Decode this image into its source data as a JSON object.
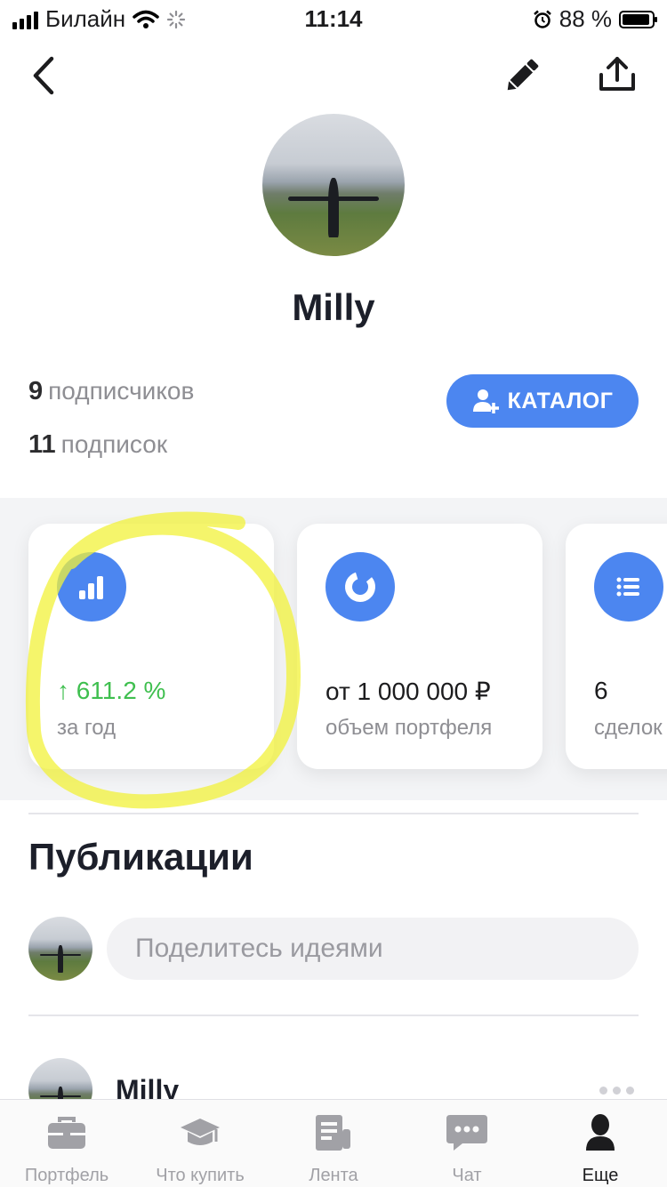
{
  "status_bar": {
    "carrier": "Билайн",
    "time": "11:14",
    "battery": "88 %"
  },
  "profile": {
    "name": "Milly",
    "followers_count": "9",
    "followers_label": "подписчиков",
    "following_count": "11",
    "following_label": "подписок",
    "catalog_button": "КАТАЛОГ"
  },
  "cards": [
    {
      "icon": "bar-chart-icon",
      "value": "↑ 611.2 %",
      "label": "за год",
      "value_color": "#3fbf4f"
    },
    {
      "icon": "donut-chart-icon",
      "value": "от 1 000 000 ₽",
      "label": "объем портфеля"
    },
    {
      "icon": "list-icon",
      "value": "6",
      "label": "сделок"
    }
  ],
  "publications": {
    "title": "Публикации",
    "composer_placeholder": "Поделитесь идеями",
    "post_author": "Milly"
  },
  "tabs": [
    {
      "label": "Портфель",
      "icon": "briefcase-icon",
      "active": false
    },
    {
      "label": "Что купить",
      "icon": "graduation-cap-icon",
      "active": false
    },
    {
      "label": "Лента",
      "icon": "news-icon",
      "active": false
    },
    {
      "label": "Чат",
      "icon": "chat-icon",
      "active": false
    },
    {
      "label": "Еще",
      "icon": "person-icon",
      "active": true
    }
  ],
  "colors": {
    "accent": "#4c86f0",
    "positive": "#3fbf4f",
    "highlight": "#f2f23a"
  }
}
